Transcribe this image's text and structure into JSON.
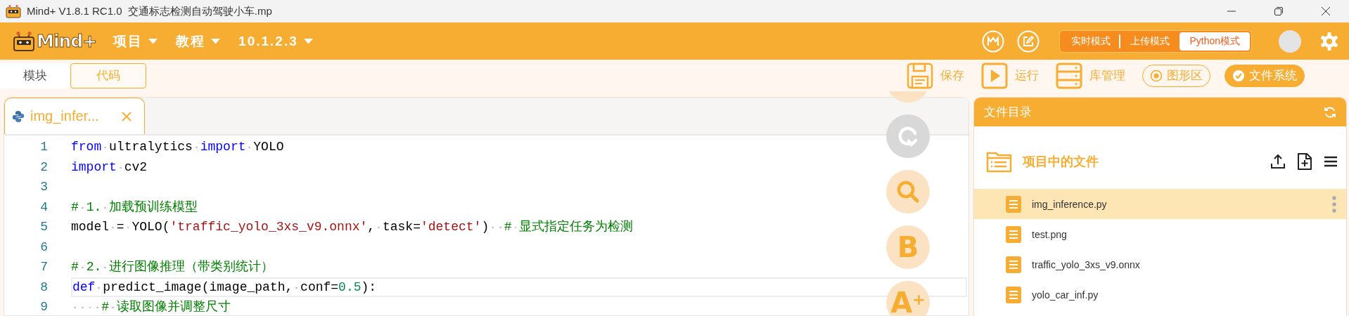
{
  "window": {
    "title": "Mind+ V1.8.1 RC1.0  交通标志检测自动驾驶小车.mp"
  },
  "menubar": {
    "logo_text": "Mind+",
    "menus": [
      "项目",
      "教程",
      "10.1.2.3"
    ],
    "modes": [
      {
        "label": "实时模式",
        "selected": false
      },
      {
        "label": "上传模式",
        "selected": false
      },
      {
        "label": "Python模式",
        "selected": true
      }
    ]
  },
  "view_tabs": [
    {
      "label": "模块",
      "selected": false
    },
    {
      "label": "代码",
      "selected": true
    }
  ],
  "actions": [
    {
      "kind": "save",
      "label": "保存"
    },
    {
      "kind": "run",
      "label": "运行"
    },
    {
      "kind": "library",
      "label": "库管理"
    },
    {
      "kind": "stage",
      "label": "图形区",
      "on": false
    },
    {
      "kind": "files",
      "label": "文件系统",
      "on": true
    }
  ],
  "editor": {
    "tabs": [
      {
        "label": "img_infer...",
        "selected": true
      }
    ],
    "lines": [
      {
        "number": "1",
        "current": false,
        "tokens": [
          {
            "kind": "kw",
            "text": "from"
          },
          {
            "kind": "plain",
            "text": " ultralytics "
          },
          {
            "kind": "kw",
            "text": "import"
          },
          {
            "kind": "plain",
            "text": " YOLO"
          }
        ]
      },
      {
        "number": "2",
        "current": false,
        "tokens": [
          {
            "kind": "kw",
            "text": "import"
          },
          {
            "kind": "plain",
            "text": " cv2"
          }
        ]
      },
      {
        "number": "3",
        "current": false
      },
      {
        "number": "4",
        "current": false,
        "tokens": [
          {
            "kind": "cm",
            "text": "# 1. 加载预训练模型"
          }
        ]
      },
      {
        "number": "5",
        "current": false,
        "tokens": [
          {
            "kind": "plain",
            "text": "model = YOLO("
          },
          {
            "kind": "str",
            "text": "'traffic_yolo_3xs_v9.onnx'"
          },
          {
            "kind": "plain",
            "text": ", task="
          },
          {
            "kind": "str",
            "text": "'detect'"
          },
          {
            "kind": "plain",
            "text": ")  "
          },
          {
            "kind": "cm",
            "text": "# 显式指定任务为检测"
          }
        ]
      },
      {
        "number": "6",
        "current": false
      },
      {
        "number": "7",
        "current": false,
        "tokens": [
          {
            "kind": "cm",
            "text": "# 2. 进行图像推理（带类别统计）"
          }
        ]
      },
      {
        "number": "8",
        "current": true,
        "tokens": [
          {
            "kind": "kw",
            "text": "def"
          },
          {
            "kind": "plain",
            "text": " predict_image(image_path, conf="
          },
          {
            "kind": "num",
            "text": "0.5"
          },
          {
            "kind": "plain",
            "text": "):"
          }
        ]
      },
      {
        "number": "9",
        "current": false,
        "tokens": [
          {
            "kind": "cm",
            "text": "    # 读取图像并调整尺寸"
          }
        ]
      }
    ]
  },
  "float_tools": [
    {
      "kind": "clipped",
      "disabled": false
    },
    {
      "kind": "redo",
      "disabled": true
    },
    {
      "kind": "search",
      "disabled": false
    },
    {
      "kind": "glyph",
      "glyph": "B",
      "disabled": false
    },
    {
      "kind": "glyph",
      "glyph": "A$^{+}$",
      "disabled": false
    }
  ],
  "file_panel": {
    "title": "文件目录",
    "folder": "项目中的文件",
    "files": [
      {
        "name": "img_inference.py",
        "selected": true
      },
      {
        "name": "test.png",
        "selected": false
      },
      {
        "name": "traffic_yolo_3xs_v9.onnx",
        "selected": false
      },
      {
        "name": "yolo_car_inf.py",
        "selected": false
      }
    ]
  }
}
